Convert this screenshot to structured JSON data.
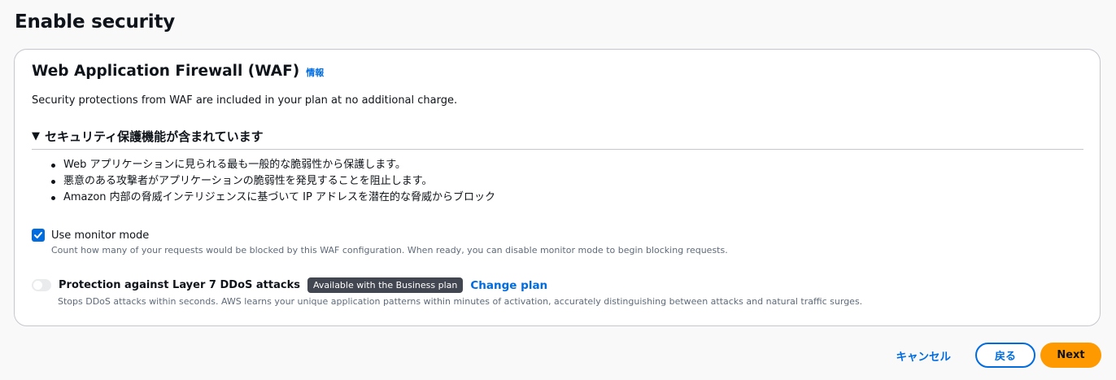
{
  "page": {
    "title": "Enable security"
  },
  "waf": {
    "title": "Web Application Firewall (WAF)",
    "info_link": "情報",
    "description": "Security protections from WAF are included in your plan at no additional charge."
  },
  "expander": {
    "label": "セキュリティ保護機能が含まれています",
    "expanded": true,
    "items": [
      "Web アプリケーションに見られる最も一般的な脆弱性から保護します。",
      "悪意のある攻撃者がアプリケーションの脆弱性を発見することを阻止します。",
      "Amazon 内部の脅威インテリジェンスに基づいて IP アドレスを潜在的な脅威からブロック"
    ]
  },
  "monitor": {
    "label": "Use monitor mode",
    "checked": true,
    "description": "Count how many of your requests would be blocked by this WAF configuration. When ready, you can disable monitor mode to begin blocking requests."
  },
  "ddos": {
    "label": "Protection against Layer 7 DDoS attacks",
    "enabled": false,
    "badge": "Available with the Business plan",
    "change_plan": "Change plan",
    "description": "Stops DDoS attacks within seconds. AWS learns your unique application patterns within minutes of activation, accurately distinguishing between attacks and natural traffic surges."
  },
  "actions": {
    "cancel": "キャンセル",
    "back": "戻る",
    "next": "Next"
  },
  "colors": {
    "link": "#006ce0",
    "primary_button": "#ff9900",
    "badge": "#424650"
  },
  "icons": {
    "expander": "caret-down-icon",
    "checkbox": "checkmark-icon"
  }
}
